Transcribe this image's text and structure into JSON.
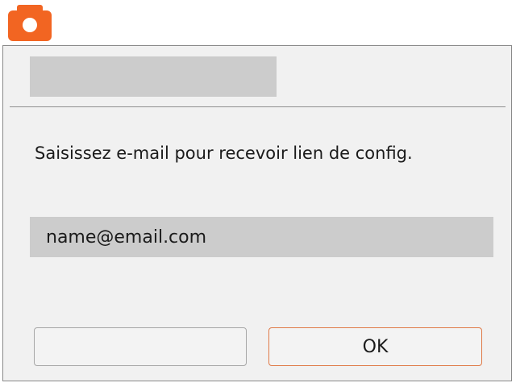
{
  "app_icon": {
    "name": "camera-icon",
    "color": "#f26522"
  },
  "dialog": {
    "title": "",
    "message": "Saisissez e-mail pour recevoir lien de config.",
    "email_input": {
      "value": "name@email.com",
      "placeholder": ""
    },
    "buttons": {
      "secondary_label": "",
      "ok_label": "OK"
    },
    "colors": {
      "accent_border": "#e07a47",
      "input_background": "#cccccc",
      "dialog_background": "#f1f1f1"
    }
  }
}
